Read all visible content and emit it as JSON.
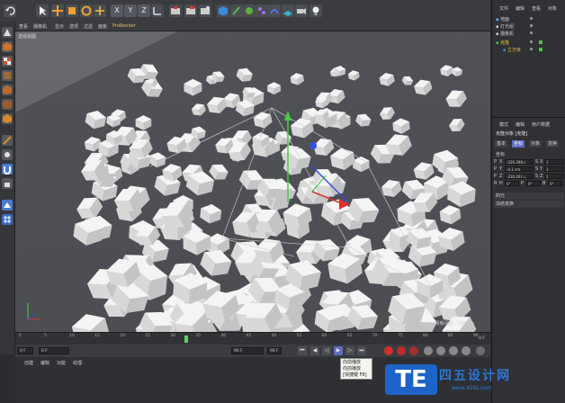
{
  "viewport": {
    "menu": [
      "查看",
      "摄像机",
      "显示",
      "选项",
      "过滤",
      "面板",
      "ProRender"
    ],
    "label": "透视视图",
    "grid_spacing": "网格间距：100 cm"
  },
  "toolbar": {
    "axis_x": "X",
    "axis_y": "Y",
    "axis_z": "Z"
  },
  "timeline": {
    "ticks": [
      "0",
      "5",
      "10",
      "15",
      "20",
      "25",
      "30",
      "35",
      "40",
      "45",
      "50",
      "55",
      "60",
      "65",
      "70",
      "75",
      "80",
      "85",
      "90"
    ],
    "current_frame": "0 F",
    "start_field": "0 F",
    "min_field": "0 F",
    "end_field": "90 F",
    "max_field": "90 F",
    "current_frame_right": "0 F"
  },
  "tooltip": {
    "line1": "向前播放",
    "line2": "向前播放",
    "line3": "[快捷键 F8]"
  },
  "material_manager": {
    "menu": [
      "创建",
      "编辑",
      "功能",
      "纹理"
    ]
  },
  "object_manager": {
    "tabs": [
      "文件",
      "编辑",
      "查看",
      "对象"
    ],
    "items": [
      {
        "name": "地面"
      },
      {
        "name": "灯光组"
      },
      {
        "name": "摄像机"
      },
      {
        "name": "克隆"
      },
      {
        "name": "立方体"
      }
    ]
  },
  "attributes": {
    "menu": [
      "模式",
      "编辑",
      "用户数据"
    ],
    "object_title": "克隆对象 [克隆]",
    "tabs": [
      "基本",
      "坐标",
      "对象",
      "变换"
    ],
    "active_tab": "坐标",
    "section": "坐标",
    "p_x": "-226.398 c",
    "p_y": "-0.1 cm",
    "p_z": "-230.261 c",
    "s_x": "1",
    "s_y": "1",
    "s_z": "1",
    "r_h": "0°",
    "r_p": "0°",
    "r_b": "0°",
    "label_p": "P",
    "label_s": "S",
    "label_r": "R",
    "axis_x": "X",
    "axis_y": "Y",
    "axis_z": "Z",
    "axis_h": "H",
    "axis_p": "P",
    "axis_b": "B",
    "section_quat": "四元",
    "section_freeze": "冻结变换"
  },
  "watermark": {
    "logo": "TE",
    "name": "四五设计网",
    "url": "www.45te.com"
  },
  "colors": {
    "accent": "#5e6cc0",
    "selection": "#e8c040",
    "cube": "#eeeeee",
    "viewport_bg": "#4c4e53"
  }
}
